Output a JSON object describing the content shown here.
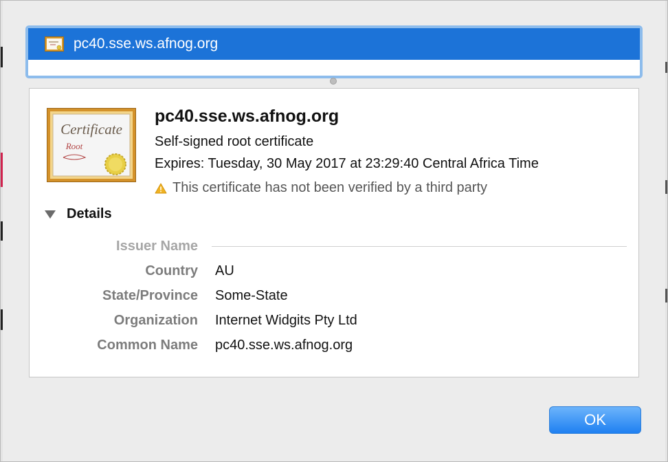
{
  "chain": {
    "selected_item": "pc40.sse.ws.afnog.org"
  },
  "certificate": {
    "title": "pc40.sse.ws.afnog.org",
    "type": "Self-signed root certificate",
    "expires": "Expires: Tuesday, 30 May 2017 at 23:29:40 Central Africa Time",
    "warning": "This certificate has not been verified by a third party",
    "icon_text_line1": "Certificate",
    "icon_text_line2": "Root"
  },
  "details": {
    "toggle_label": "Details",
    "section_title": "Issuer Name",
    "fields": [
      {
        "label": "Country",
        "value": "AU"
      },
      {
        "label": "State/Province",
        "value": "Some-State"
      },
      {
        "label": "Organization",
        "value": "Internet Widgits Pty Ltd"
      },
      {
        "label": "Common Name",
        "value": "pc40.sse.ws.afnog.org"
      }
    ]
  },
  "buttons": {
    "ok_label": "OK"
  },
  "colors": {
    "selection": "#1c73d8",
    "focus_ring": "#8dbcec",
    "button": "#1f80f1"
  }
}
